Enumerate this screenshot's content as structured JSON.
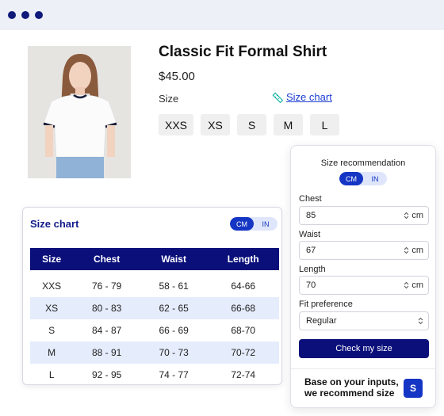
{
  "product": {
    "title": "Classic Fit Formal Shirt",
    "price": "$45.00",
    "size_label": "Size",
    "size_chart_link": "Size chart",
    "sizes": [
      "XXS",
      "XS",
      "S",
      "M",
      "L"
    ]
  },
  "size_chart": {
    "title": "Size chart",
    "units": [
      "CM",
      "IN"
    ],
    "active_unit": "CM",
    "columns": [
      "Size",
      "Chest",
      "Waist",
      "Length"
    ],
    "rows": [
      [
        "XXS",
        "76 - 79",
        "58 - 61",
        "64-66"
      ],
      [
        "XS",
        "80 - 83",
        "62 - 65",
        "66-68"
      ],
      [
        "S",
        "84 - 87",
        "66 - 69",
        "68-70"
      ],
      [
        "M",
        "88 - 91",
        "70 - 73",
        "70-72"
      ],
      [
        "L",
        "92 - 95",
        "74 - 77",
        "72-74"
      ]
    ]
  },
  "recommendation": {
    "title": "Size recommendation",
    "units": [
      "CM",
      "IN"
    ],
    "active_unit": "CM",
    "chest_label": "Chest",
    "chest_value": "85",
    "waist_label": "Waist",
    "waist_value": "67",
    "length_label": "Length",
    "length_value": "70",
    "unit_suffix": "cm",
    "fit_label": "Fit preference",
    "fit_value": "Regular",
    "check_button": "Check my size",
    "result_text": "Base on your inputs, we recommend size",
    "result_size": "S"
  },
  "colors": {
    "navy": "#0a0f7a",
    "accent_blue": "#1535c4",
    "link_blue": "#1a3dd1",
    "alt_row": "#e5ecfb",
    "window_dots": "#0f1a7a"
  }
}
